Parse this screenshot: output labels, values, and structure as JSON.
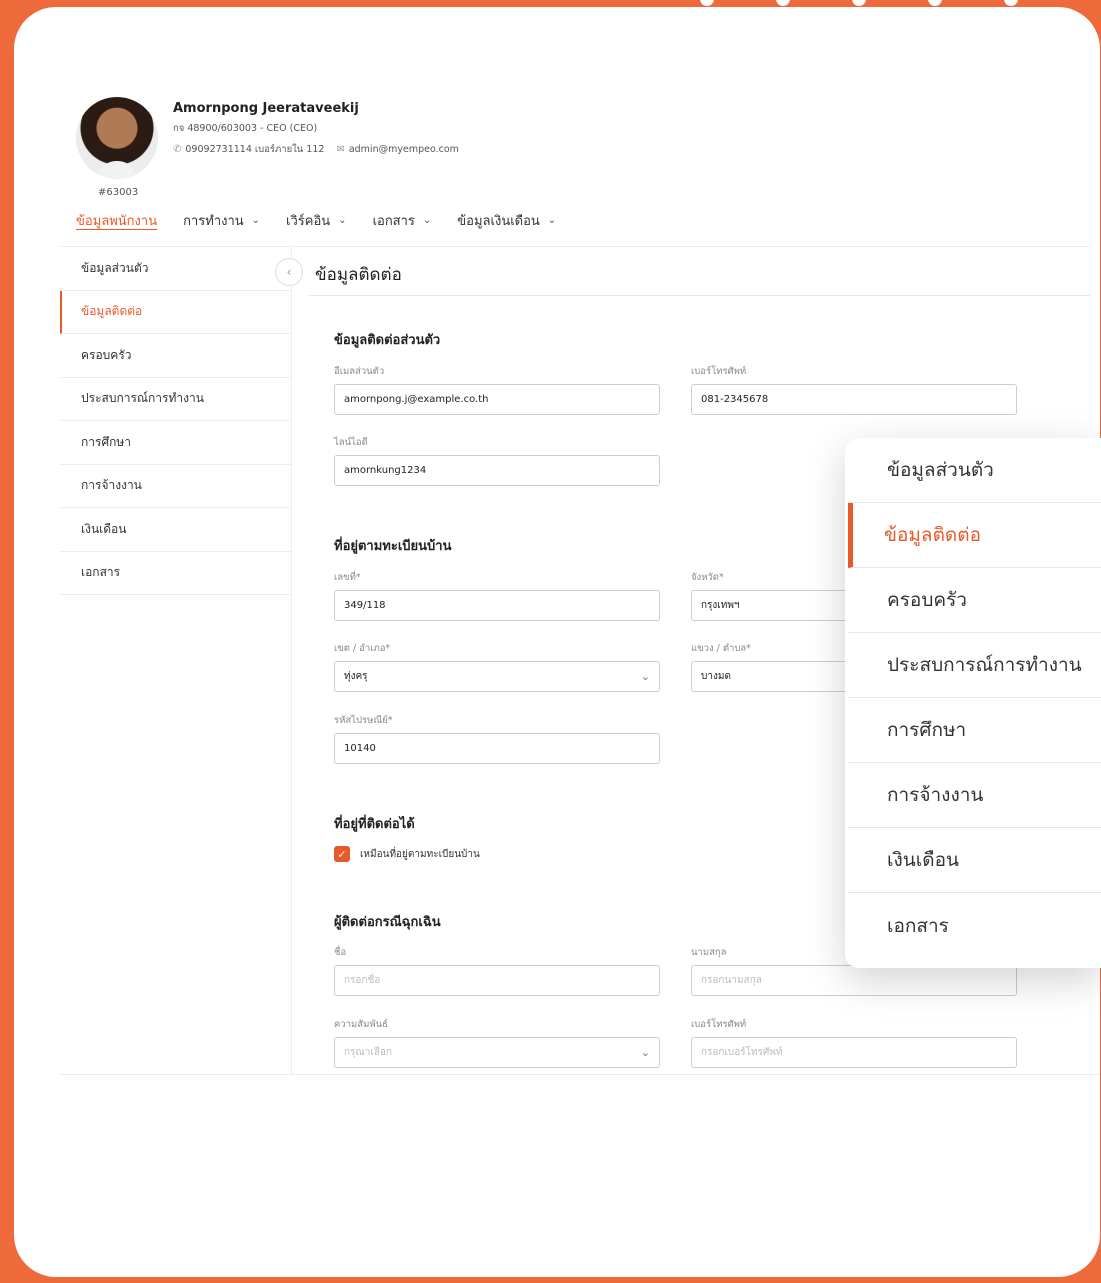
{
  "colors": {
    "accent": "#e8592a",
    "frame": "#ee6a3a"
  },
  "profile": {
    "name": "Amornpong Jeerataveekij",
    "position": "กจ 48900/603003 - CEO (CEO)",
    "phone": "09092731114 เบอร์ภายใน 112",
    "email": "admin@myempeo.com",
    "employee_id": "#63003",
    "phone_icon": "phone-icon",
    "email_icon": "mail-icon"
  },
  "tabs": [
    {
      "label": "ข้อมูลพนักงาน"
    },
    {
      "label": "การทำงาน"
    },
    {
      "label": "เวิร์คอิน"
    },
    {
      "label": "เอกสาร"
    },
    {
      "label": "ข้อมูลเงินเดือน"
    }
  ],
  "sidebar": {
    "items": [
      {
        "label": "ข้อมูลส่วนตัว"
      },
      {
        "label": "ข้อมูลติดต่อ"
      },
      {
        "label": "ครอบครัว"
      },
      {
        "label": "ประสบการณ์การทำงาน"
      },
      {
        "label": "การศึกษา"
      },
      {
        "label": "การจ้างงาน"
      },
      {
        "label": "เงินเดือน"
      },
      {
        "label": "เอกสาร"
      }
    ]
  },
  "main": {
    "title": "ข้อมูลติดต่อ",
    "personal": {
      "title": "ข้อมูลติดต่อส่วนตัว",
      "email_label": "อีเมลส่วนตัว",
      "email_value": "amornpong.j@example.co.th",
      "phone_label": "เบอร์โทรศัพท์",
      "phone_value": "081-2345678",
      "line_label": "ไลน์ไอดี",
      "line_value": "amornkung1234"
    },
    "address": {
      "title": "ที่อยู่ตามทะเบียนบ้าน",
      "number_label": "เลขที่*",
      "number_value": "349/118",
      "province_label": "จังหวัด*",
      "province_value": "กรุงเทพฯ",
      "district_label": "เขต / อำเภอ*",
      "district_value": "ทุ่งครุ",
      "subdistrict_label": "แขวง / ตำบล*",
      "subdistrict_value": "บางมด",
      "postal_label": "รหัสไปรษณีย์*",
      "postal_value": "10140"
    },
    "contact_address": {
      "title": "ที่อยู่ที่ติดต่อได้",
      "same_as_label": "เหมือนที่อยู่ตามทะเบียนบ้าน"
    },
    "emergency": {
      "title": "ผู้ติดต่อกรณีฉุกเฉิน",
      "name_label": "ชื่อ",
      "name_placeholder": "กรอกชื่อ",
      "surname_label": "นามสกุล",
      "surname_placeholder": "กรอกนามสกุล",
      "relation_label": "ความสัมพันธ์",
      "relation_placeholder": "กรุณาเลือก",
      "phone_label": "เบอร์โทรศัพท์",
      "phone_placeholder": "กรอกเบอร์โทรศัพท์"
    }
  },
  "overlay_menu": {
    "items": [
      {
        "label": "ข้อมูลส่วนตัว"
      },
      {
        "label": "ข้อมูลติดต่อ"
      },
      {
        "label": "ครอบครัว"
      },
      {
        "label": "ประสบการณ์การทำงาน"
      },
      {
        "label": "การศึกษา"
      },
      {
        "label": "การจ้างงาน"
      },
      {
        "label": "เงินเดือน"
      },
      {
        "label": "เอกสาร"
      }
    ]
  }
}
